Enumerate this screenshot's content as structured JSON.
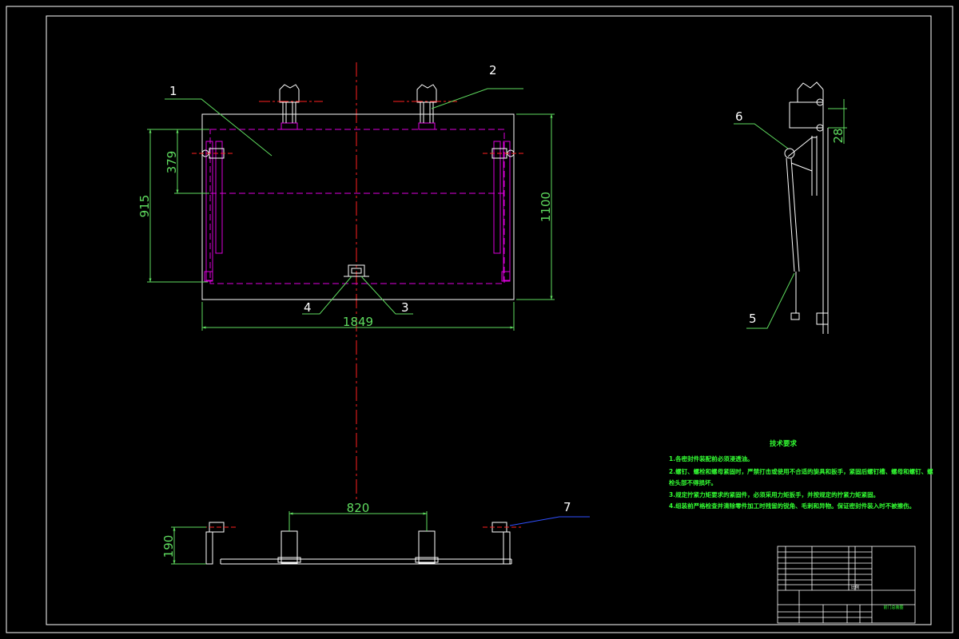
{
  "drawing": {
    "part_labels": [
      "1",
      "2",
      "3",
      "4",
      "5",
      "6",
      "7"
    ],
    "dimensions": {
      "overall_width": "1849",
      "overall_height": "1100",
      "left_height": "915",
      "upper_height": "379",
      "bracket_spacing": "820",
      "bottom_height": "190",
      "side_offset": "28"
    },
    "technical_requirements": {
      "title": "技术要求",
      "items": [
        "1.各密封件装配前必须浸透油。",
        "2.螺钉、螺栓和螺母紧固时，严禁打击或使用不合适的旋具和扳手，紧固后螺钉槽、螺母和螺钉、螺",
        "栓头部不得损坏。",
        "3.规定拧紧力矩要求的紧固件，必须采用力矩扳手，并按规定的拧紧力矩紧固。",
        "4.组装前严格检查并清除零件加工时残留的锐角、毛刺和异物。保证密封件装入时不被擦伤。"
      ]
    },
    "title_block": {
      "drawing_name": "前门总装图",
      "scale_label": "比例"
    },
    "colors": {
      "background": "#000000",
      "outline": "#ffffff",
      "dimension": "#5fdc5f",
      "hidden": "#dd00dd",
      "centerline": "#ff2020",
      "leader_blue": "#3050ff"
    }
  }
}
